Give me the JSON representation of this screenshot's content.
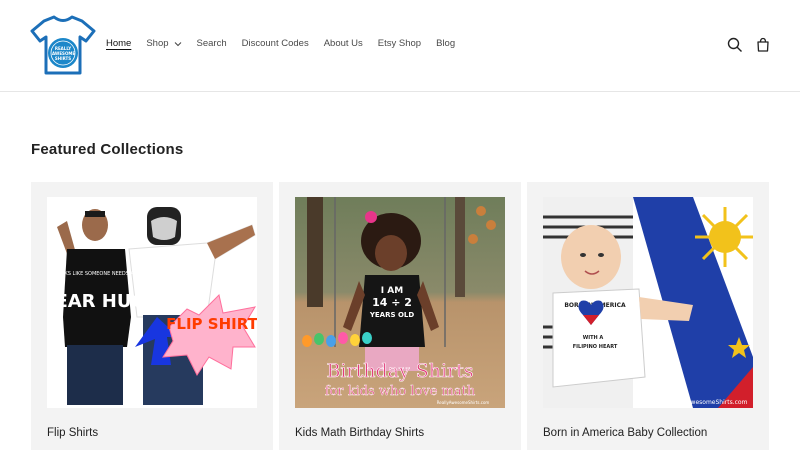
{
  "header": {
    "logo_text": "REALLY AWESOME SHIRTS",
    "nav": [
      {
        "label": "Home"
      },
      {
        "label": "Shop"
      },
      {
        "label": "Search"
      },
      {
        "label": "Discount Codes"
      },
      {
        "label": "About Us"
      },
      {
        "label": "Etsy Shop"
      },
      {
        "label": "Blog"
      }
    ],
    "active_nav": "Home",
    "icons": [
      "search-icon",
      "cart-icon"
    ]
  },
  "main": {
    "section_title": "Featured Collections",
    "collections": [
      {
        "title": "Flip Shirts",
        "image_text": {
          "shirt_small": "LOOKS LIKE SOMEONE NEEDS A",
          "shirt_big": "BEAR HUG",
          "burst": "FLIP SHIRT"
        }
      },
      {
        "title": "Kids Math Birthday Shirts",
        "image_text": {
          "shirt_line1": "I AM",
          "shirt_line2": "14 ÷ 2",
          "shirt_line3": "YEARS OLD",
          "caption1": "Birthday Shirts",
          "caption2": "for kids who love math",
          "watermark": "ReallyAwesomeShirts.com"
        }
      },
      {
        "title": "Born in America Baby Collection",
        "image_text": {
          "onesie_top": "BORN IN AMERICA",
          "onesie_mid": "WITH A",
          "onesie_bottom": "FILIPINO HEART",
          "watermark": "ReallyAwesomeShirts.com"
        }
      }
    ]
  },
  "colors": {
    "card_bg": "#f3f3f3",
    "text": "#222222",
    "flag_blue": "#1f3fa8",
    "flag_red": "#d21f2b",
    "flag_yellow": "#f2c21b"
  }
}
